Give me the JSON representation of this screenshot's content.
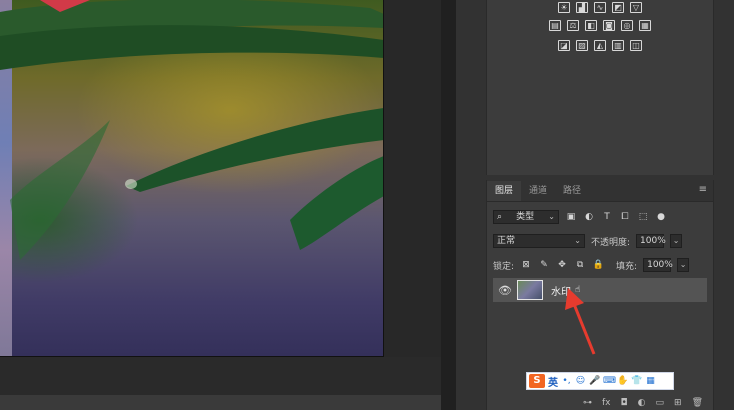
{
  "adjustments": {
    "row1": [
      "sun-icon",
      "histogram-icon",
      "curves-icon",
      "exposure-icon",
      "triangle-icon"
    ],
    "row2": [
      "vibrance-icon",
      "balance-icon",
      "bw-icon",
      "camera-icon",
      "mixer-icon",
      "grid-icon"
    ],
    "row3": [
      "invert-icon",
      "posterize-icon",
      "threshold-icon",
      "gradientmap-icon",
      "selective-icon"
    ]
  },
  "layers_panel": {
    "tabs": [
      "图层",
      "通道",
      "路径"
    ],
    "menu_glyph": "≡",
    "filter": {
      "icon": "⌕",
      "label": "类型"
    },
    "filter_icons": [
      "▣",
      "◐",
      "T",
      "⧠",
      "⬚",
      "●"
    ],
    "blend_mode": "正常",
    "opacity_label": "不透明度:",
    "opacity_value": "100%",
    "lock_label": "锁定:",
    "lock_icons": [
      "⊠",
      "✎",
      "✥",
      "⧉",
      "🔒"
    ],
    "fill_label": "填充:",
    "fill_value": "100%",
    "layer": {
      "visible": true,
      "name": "水印"
    },
    "bottom_icons": [
      "⊶",
      "fx",
      "◘",
      "◐",
      "▭",
      "⊞",
      "🗑"
    ]
  },
  "ime": {
    "logo": "S",
    "mode": "英",
    "icons": [
      "•,",
      "☺",
      "🎤",
      "⌨",
      "✋",
      "👕",
      "▦"
    ]
  }
}
